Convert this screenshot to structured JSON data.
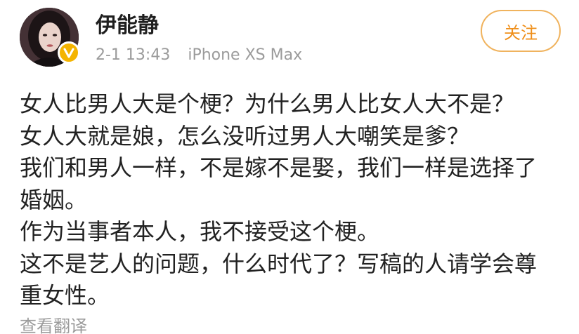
{
  "post": {
    "username": "伊能静",
    "date": "2-1 13:43",
    "device": "iPhone XS Max",
    "follow_label": "关注",
    "lines": [
      "女人比男人大是个梗？为什么男人比女人大不是？",
      "女人大就是娘，怎么没听过男人大嘲笑是爹？",
      "我们和男人一样，不是嫁不是娶，我们一样是选择了",
      "婚姻。",
      "作为当事者本人，我不接受这个梗。",
      "这不是艺人的问题，什么时代了？写稿的人请学会尊",
      "重女性。"
    ],
    "translate_label": "查看翻译"
  },
  "icons": {
    "verified": "verified-v-icon",
    "avatar": "avatar-photo"
  },
  "colors": {
    "follow_border": "#f0b35e",
    "follow_text": "#ef8f1a",
    "badge": "#f4b400",
    "meta_text": "#9b9b9b",
    "body_text": "#222222"
  }
}
